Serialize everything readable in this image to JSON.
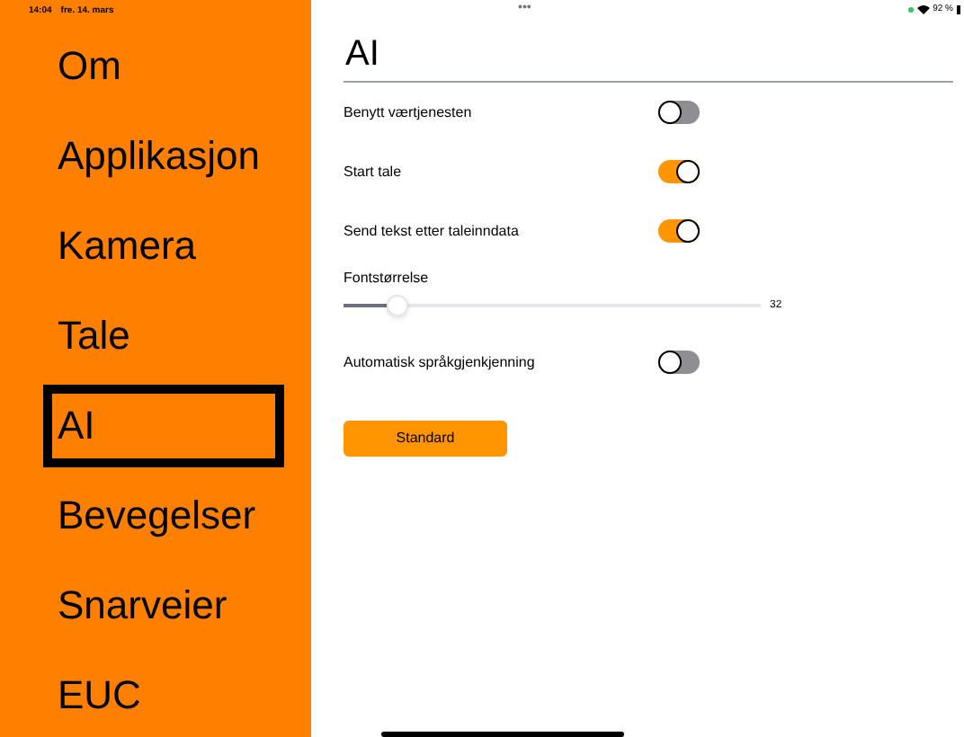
{
  "status_bar": {
    "time": "14:04",
    "date": "fre. 14. mars",
    "dots": "•••",
    "battery": "92 %"
  },
  "sidebar": {
    "items": [
      {
        "label": "Om",
        "selected": false
      },
      {
        "label": "Applikasjon",
        "selected": false
      },
      {
        "label": "Kamera",
        "selected": false
      },
      {
        "label": "Tale",
        "selected": false
      },
      {
        "label": "AI",
        "selected": true
      },
      {
        "label": "Bevegelser",
        "selected": false
      },
      {
        "label": "Snarveier",
        "selected": false
      },
      {
        "label": "EUC",
        "selected": false
      }
    ]
  },
  "title": "AI",
  "settings": [
    {
      "kind": "toggle",
      "label": "Benytt værtjenesten",
      "on": false
    },
    {
      "kind": "toggle",
      "label": "Start tale",
      "on": true
    },
    {
      "kind": "toggle",
      "label": "Send tekst etter taleinndata",
      "on": true
    },
    {
      "kind": "slider",
      "label": "Fontstørrelse",
      "level": 0.13,
      "reading": "32"
    },
    {
      "kind": "toggle",
      "label": "Automatisk språkgjenkjenning",
      "on": false
    }
  ],
  "button": "Standard"
}
